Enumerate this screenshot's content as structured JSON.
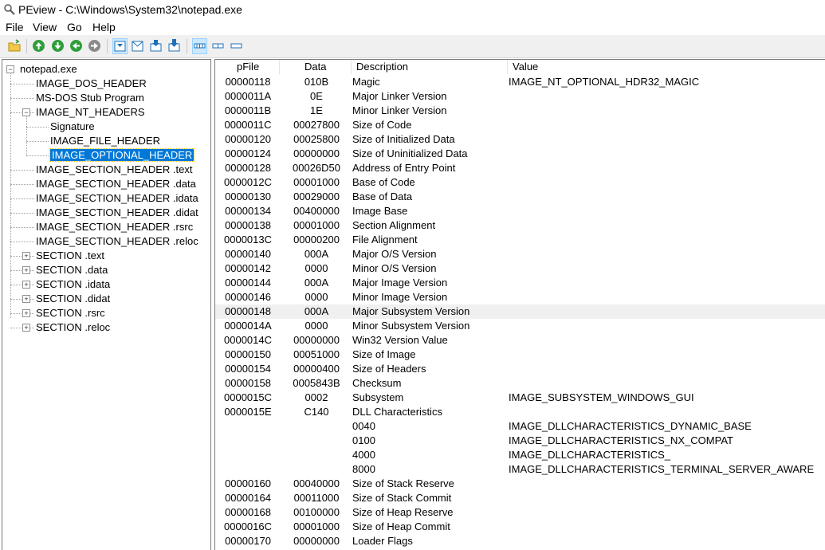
{
  "window": {
    "title": "PEview - C:\\Windows\\System32\\notepad.exe"
  },
  "menu": [
    "File",
    "View",
    "Go",
    "Help"
  ],
  "tree": {
    "root": "notepad.exe",
    "items": [
      "IMAGE_DOS_HEADER",
      "MS-DOS Stub Program",
      "IMAGE_NT_HEADERS",
      "Signature",
      "IMAGE_FILE_HEADER",
      "IMAGE_OPTIONAL_HEADER",
      "IMAGE_SECTION_HEADER .text",
      "IMAGE_SECTION_HEADER .data",
      "IMAGE_SECTION_HEADER .idata",
      "IMAGE_SECTION_HEADER .didat",
      "IMAGE_SECTION_HEADER .rsrc",
      "IMAGE_SECTION_HEADER .reloc",
      "SECTION .text",
      "SECTION .data",
      "SECTION .idata",
      "SECTION .didat",
      "SECTION .rsrc",
      "SECTION .reloc"
    ],
    "selected": "IMAGE_OPTIONAL_HEADER"
  },
  "table": {
    "columns": [
      "pFile",
      "Data",
      "Description",
      "Value"
    ],
    "rows": [
      [
        "00000118",
        "010B",
        "Magic",
        "IMAGE_NT_OPTIONAL_HDR32_MAGIC"
      ],
      [
        "0000011A",
        "0E",
        "Major Linker Version",
        ""
      ],
      [
        "0000011B",
        "1E",
        "Minor Linker Version",
        ""
      ],
      [
        "0000011C",
        "00027800",
        "Size of Code",
        ""
      ],
      [
        "00000120",
        "00025800",
        "Size of Initialized Data",
        ""
      ],
      [
        "00000124",
        "00000000",
        "Size of Uninitialized Data",
        ""
      ],
      [
        "00000128",
        "00026D50",
        "Address of Entry Point",
        ""
      ],
      [
        "0000012C",
        "00001000",
        "Base of Code",
        ""
      ],
      [
        "00000130",
        "00029000",
        "Base of Data",
        ""
      ],
      [
        "00000134",
        "00400000",
        "Image Base",
        ""
      ],
      [
        "00000138",
        "00001000",
        "Section Alignment",
        ""
      ],
      [
        "0000013C",
        "00000200",
        "File Alignment",
        ""
      ],
      [
        "00000140",
        "000A",
        "Major O/S Version",
        ""
      ],
      [
        "00000142",
        "0000",
        "Minor O/S Version",
        ""
      ],
      [
        "00000144",
        "000A",
        "Major Image Version",
        ""
      ],
      [
        "00000146",
        "0000",
        "Minor Image Version",
        ""
      ],
      [
        "00000148",
        "000A",
        "Major Subsystem Version",
        ""
      ],
      [
        "0000014A",
        "0000",
        "Minor Subsystem Version",
        ""
      ],
      [
        "0000014C",
        "00000000",
        "Win32 Version Value",
        ""
      ],
      [
        "00000150",
        "00051000",
        "Size of Image",
        ""
      ],
      [
        "00000154",
        "00000400",
        "Size of Headers",
        ""
      ],
      [
        "00000158",
        "0005843B",
        "Checksum",
        ""
      ],
      [
        "0000015C",
        "0002",
        "Subsystem",
        "IMAGE_SUBSYSTEM_WINDOWS_GUI"
      ],
      [
        "0000015E",
        "C140",
        "DLL Characteristics",
        ""
      ],
      [
        "",
        "",
        "0040",
        "IMAGE_DLLCHARACTERISTICS_DYNAMIC_BASE"
      ],
      [
        "",
        "",
        "0100",
        "IMAGE_DLLCHARACTERISTICS_NX_COMPAT"
      ],
      [
        "",
        "",
        "4000",
        "IMAGE_DLLCHARACTERISTICS_"
      ],
      [
        "",
        "",
        "8000",
        "IMAGE_DLLCHARACTERISTICS_TERMINAL_SERVER_AWARE"
      ],
      [
        "00000160",
        "00040000",
        "Size of Stack Reserve",
        ""
      ],
      [
        "00000164",
        "00011000",
        "Size of Stack Commit",
        ""
      ],
      [
        "00000168",
        "00100000",
        "Size of Heap Reserve",
        ""
      ],
      [
        "0000016C",
        "00001000",
        "Size of Heap Commit",
        ""
      ],
      [
        "00000170",
        "00000000",
        "Loader Flags",
        ""
      ]
    ],
    "highlighted_row": 16
  },
  "toolbar_icons": [
    "open-icon",
    "back-icon",
    "forward-icon",
    "up-icon",
    "down-icon",
    "view-first-icon",
    "view-prev-icon",
    "view-next-icon",
    "view-last-icon",
    "view-hex-icon",
    "view-list-icon",
    "view-byte-icon"
  ],
  "colors": {
    "selection": "#0078d7",
    "toolbar": "#f0f0f0",
    "highlight_row": "#f0f0f0"
  }
}
